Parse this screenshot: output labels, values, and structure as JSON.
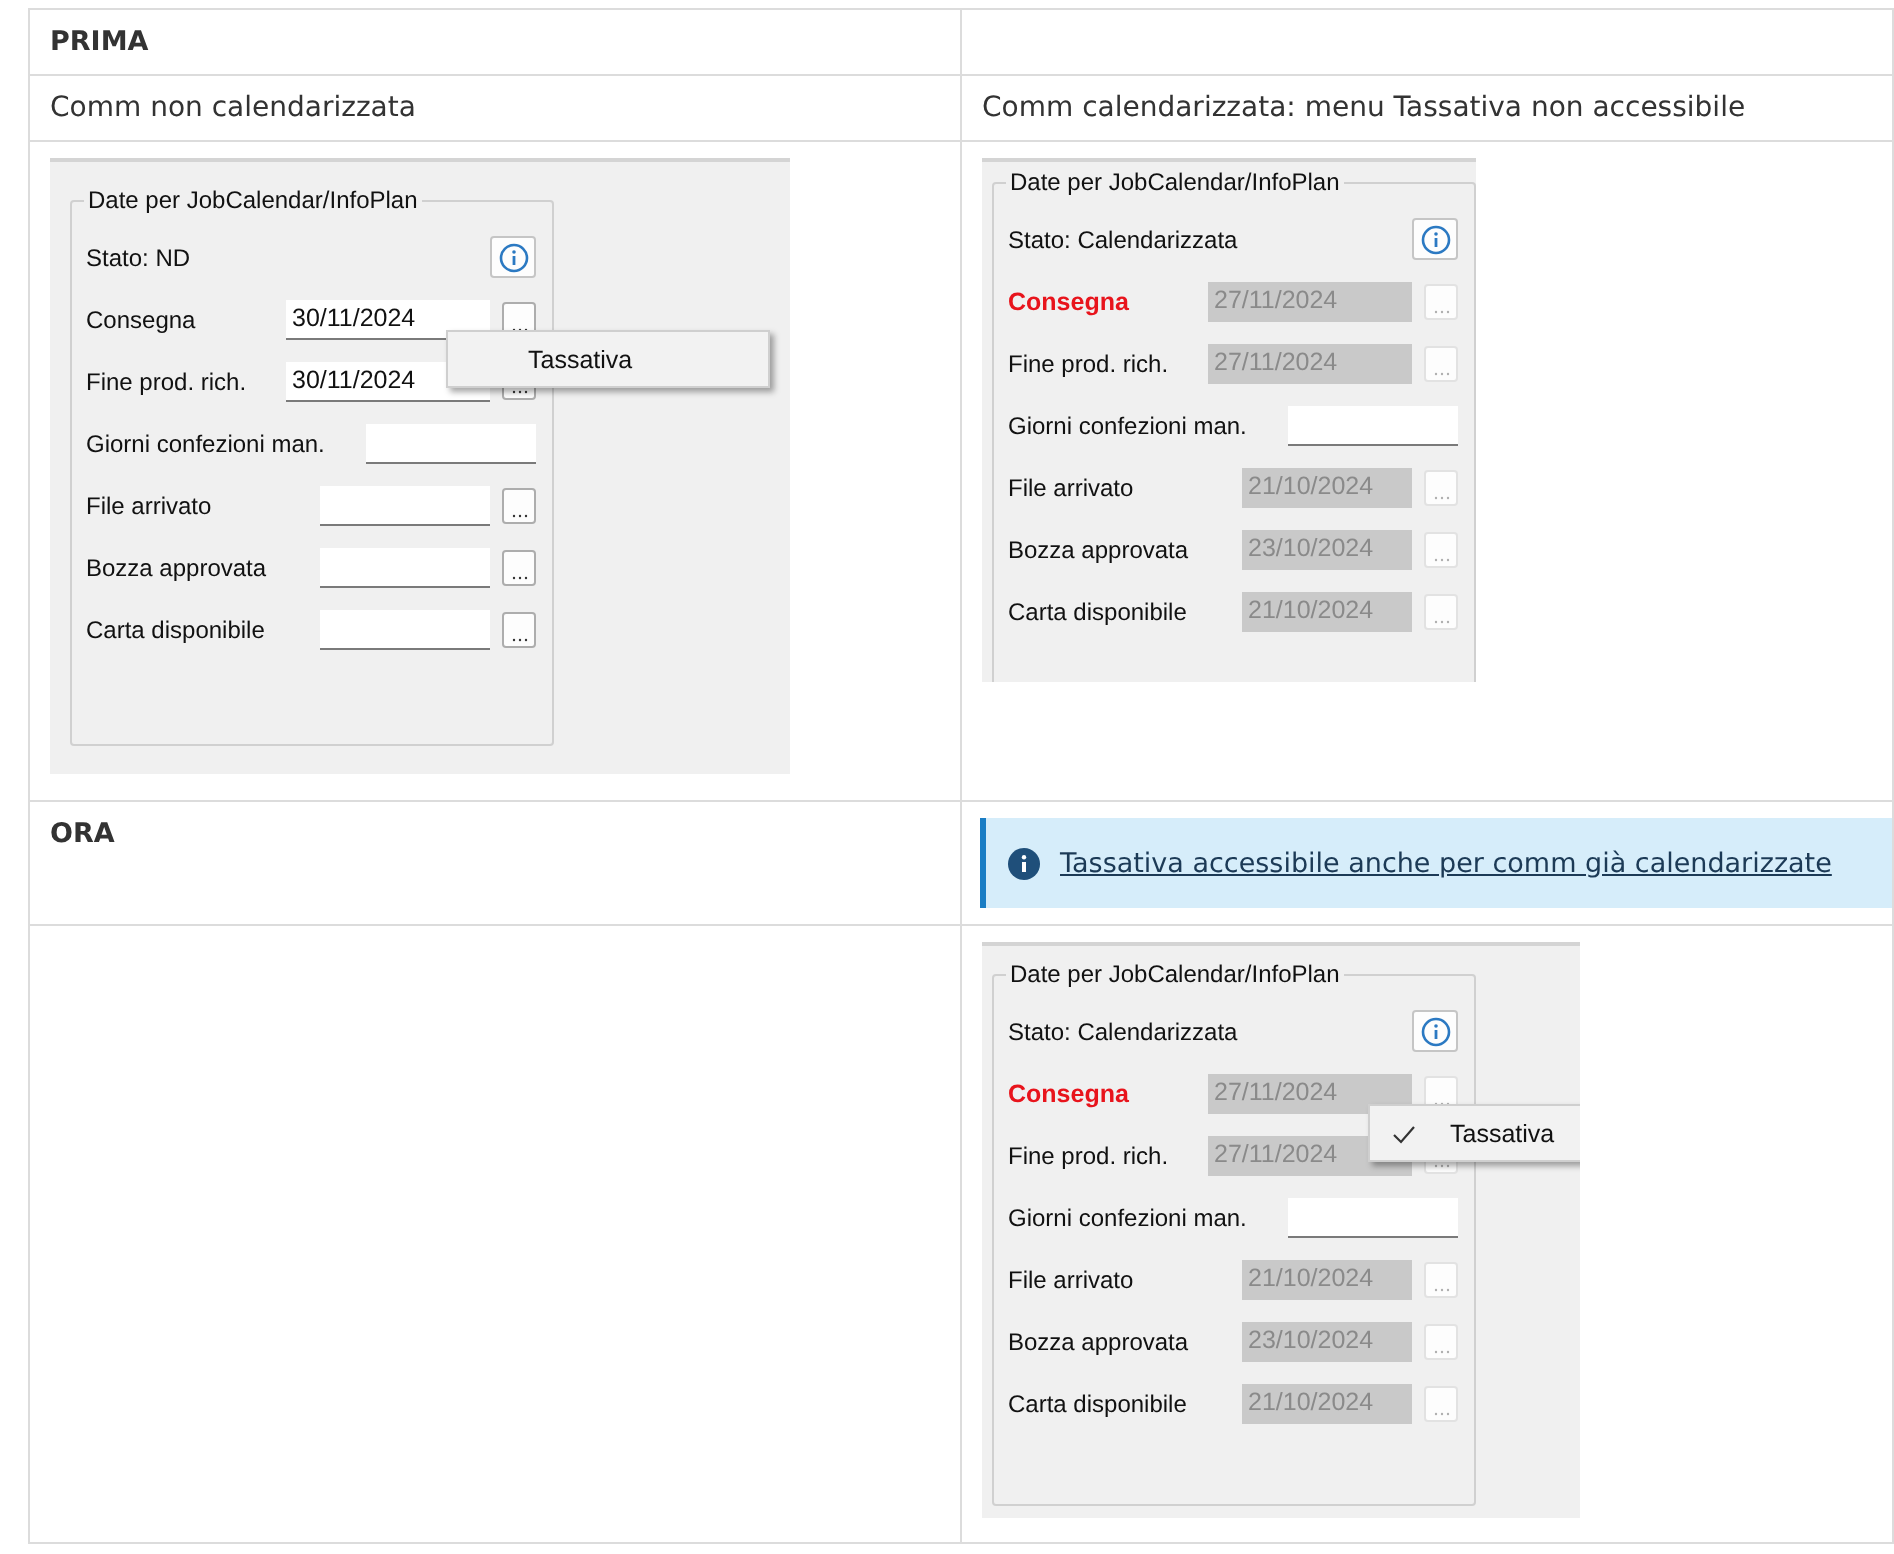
{
  "table": {
    "rows": [
      {
        "cells": [
          {
            "kind": "heading",
            "text": "PRIMA"
          },
          {
            "kind": "empty"
          }
        ]
      },
      {
        "cells": [
          {
            "kind": "text",
            "text": "Comm non calendarizzata"
          },
          {
            "kind": "text",
            "text": "Comm calendarizzata: menu Tassativa non accessibile"
          }
        ]
      },
      {
        "cells": [
          {
            "kind": "screenshot",
            "dialog": {
              "group_title": "Date per JobCalendar/InfoPlan",
              "status": "Stato: ND",
              "fields": [
                {
                  "kind": "date",
                  "label": "Consegna",
                  "value": "30/11/2024",
                  "disabled": false,
                  "emphasized": false
                },
                {
                  "kind": "date",
                  "label": "Fine prod. rich.",
                  "value": "30/11/2024",
                  "disabled": false,
                  "emphasized": false
                },
                {
                  "kind": "number",
                  "label": "Giorni confezioni man.",
                  "disabled": false,
                  "emphasized": false
                },
                {
                  "kind": "date",
                  "label": "File arrivato",
                  "disabled": false,
                  "emphasized": false
                },
                {
                  "kind": "date",
                  "label": "Bozza approvata",
                  "disabled": false,
                  "emphasized": false
                },
                {
                  "kind": "date",
                  "label": "Carta disponibile",
                  "disabled": false,
                  "emphasized": false
                }
              ],
              "menu": {
                "item": "Tassativa",
                "checked": false
              }
            }
          },
          {
            "kind": "screenshot",
            "dialog": {
              "group_title": "Date per JobCalendar/InfoPlan",
              "status": "Stato: Calendarizzata",
              "fields": [
                {
                  "kind": "date",
                  "label": "Consegna",
                  "value": "27/11/2024",
                  "disabled": true,
                  "emphasized": true
                },
                {
                  "kind": "date",
                  "label": "Fine prod. rich.",
                  "value": "27/11/2024",
                  "disabled": true,
                  "emphasized": false
                },
                {
                  "kind": "number",
                  "label": "Giorni confezioni man.",
                  "disabled": false,
                  "emphasized": false
                },
                {
                  "kind": "date",
                  "label": "File arrivato",
                  "value": "21/10/2024",
                  "disabled": true,
                  "emphasized": false
                },
                {
                  "kind": "date",
                  "label": "Bozza approvata",
                  "value": "23/10/2024",
                  "disabled": true,
                  "emphasized": false
                },
                {
                  "kind": "date",
                  "label": "Carta disponibile",
                  "value": "21/10/2024",
                  "disabled": true,
                  "emphasized": false
                }
              ]
            }
          }
        ]
      },
      {
        "cells": [
          {
            "kind": "heading",
            "text": "ORA"
          },
          {
            "kind": "info",
            "link": "Tassativa accessibile anche per comm già calendarizzate"
          }
        ]
      },
      {
        "cells": [
          {
            "kind": "empty"
          },
          {
            "kind": "screenshot",
            "dialog": {
              "group_title": "Date per JobCalendar/InfoPlan",
              "status": "Stato: Calendarizzata",
              "fields": [
                {
                  "kind": "date",
                  "label": "Consegna",
                  "value": "27/11/2024",
                  "disabled": true,
                  "emphasized": true
                },
                {
                  "kind": "date",
                  "label": "Fine prod. rich.",
                  "value": "27/11/2024",
                  "disabled": true,
                  "emphasized": false
                },
                {
                  "kind": "number",
                  "label": "Giorni confezioni man.",
                  "disabled": false,
                  "emphasized": false
                },
                {
                  "kind": "date",
                  "label": "File arrivato",
                  "value": "21/10/2024",
                  "disabled": true,
                  "emphasized": false
                },
                {
                  "kind": "date",
                  "label": "Bozza approvata",
                  "value": "23/10/2024",
                  "disabled": true,
                  "emphasized": false
                },
                {
                  "kind": "date",
                  "label": "Carta disponibile",
                  "value": "21/10/2024",
                  "disabled": true,
                  "emphasized": false
                }
              ],
              "menu": {
                "item": "Tassativa",
                "checked": true
              }
            }
          }
        ]
      }
    ]
  }
}
